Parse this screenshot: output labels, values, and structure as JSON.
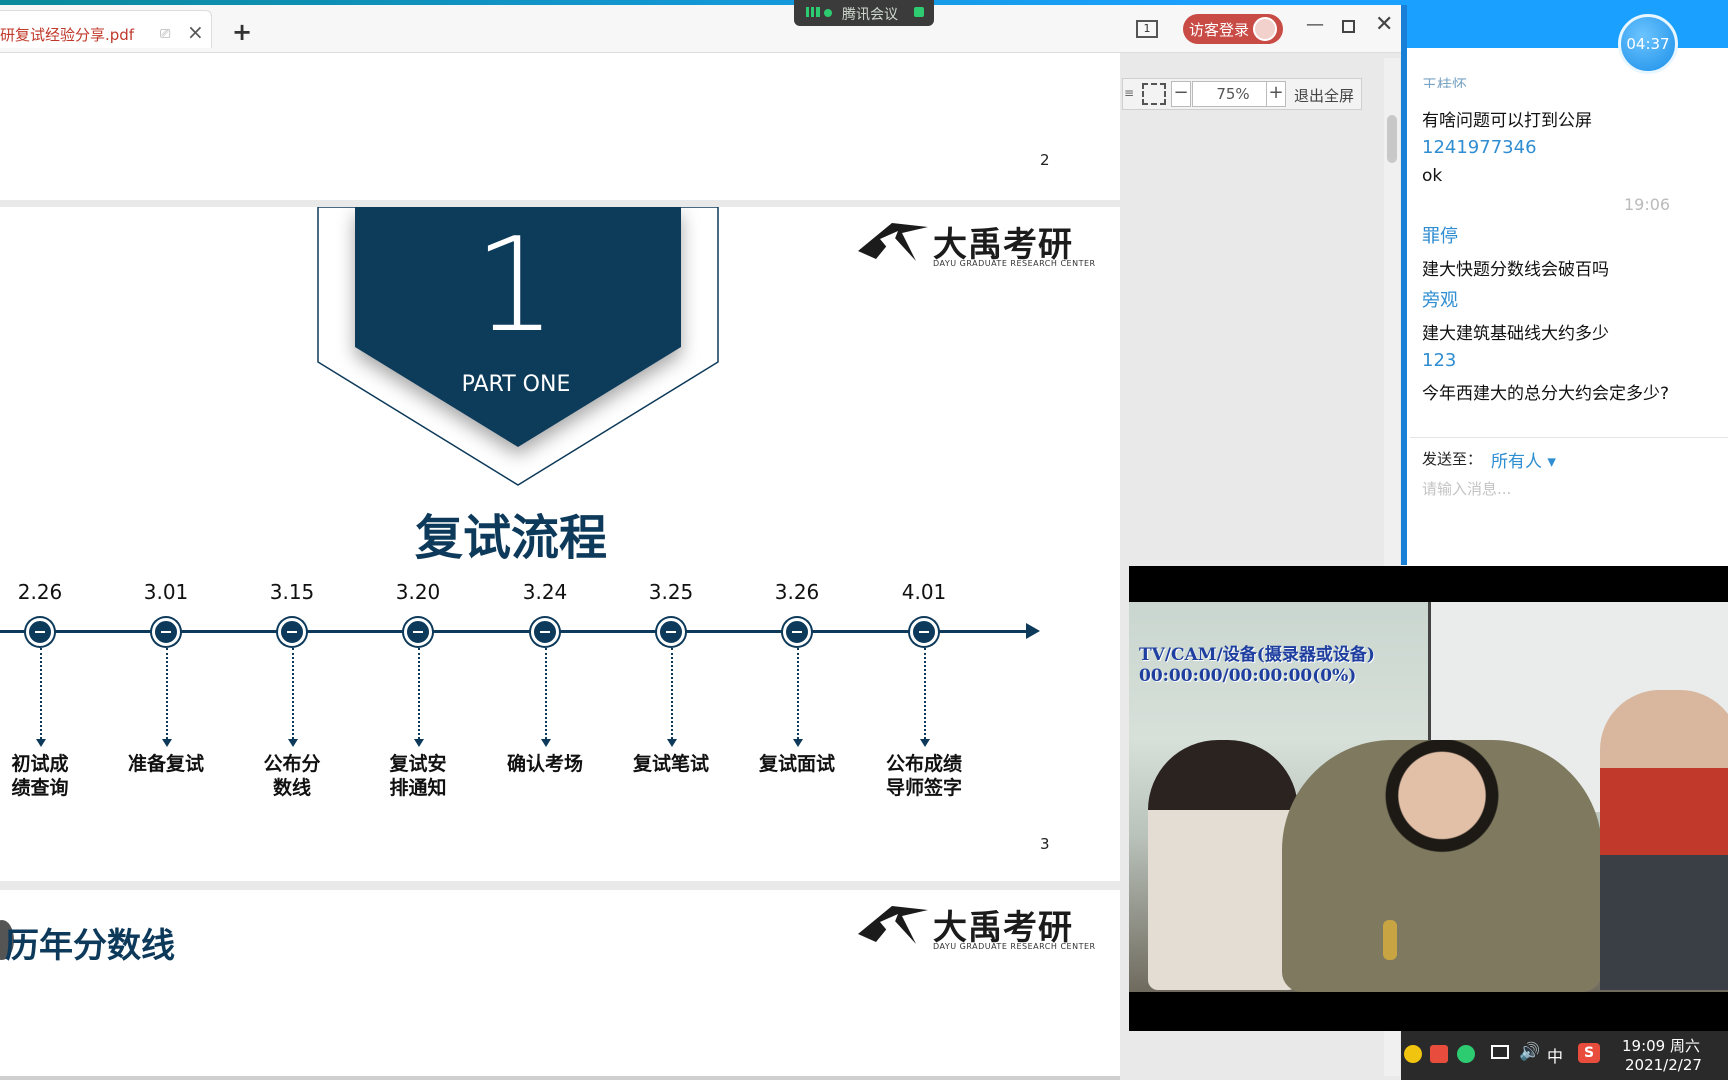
{
  "viewer": {
    "tab_title": "研复试经验分享.pdf",
    "new_tab": "+",
    "tab_close": "×",
    "page_count_icon": "1",
    "login_label": "访客登录",
    "window_min": "—",
    "window_close": "✕",
    "zoom_value": "75%",
    "zoom_minus": "−",
    "zoom_plus": "+",
    "exit_fullscreen": "退出全屏",
    "menu_glyph": "≡"
  },
  "meeting": {
    "label": "腾讯会议"
  },
  "pages": {
    "page2_number": "2",
    "page3_number": "3",
    "logo_zh": "大禹考研",
    "logo_en": "DAYU GRADUATE RESEARCH CENTER",
    "part_number": "1",
    "part_label": "PART ONE",
    "flow_title": "复试流程",
    "history_title": "历年分数线"
  },
  "timeline": [
    {
      "date": "2.26",
      "label_lines": [
        "初试成",
        "绩查询"
      ]
    },
    {
      "date": "3.01",
      "label_lines": [
        "准备复试"
      ]
    },
    {
      "date": "3.15",
      "label_lines": [
        "公布分",
        "数线"
      ]
    },
    {
      "date": "3.20",
      "label_lines": [
        "复试安",
        "排通知"
      ]
    },
    {
      "date": "3.24",
      "label_lines": [
        "确认考场"
      ]
    },
    {
      "date": "3.25",
      "label_lines": [
        "复试笔试"
      ]
    },
    {
      "date": "3.26",
      "label_lines": [
        "复试面试"
      ]
    },
    {
      "date": "4.01",
      "label_lines": [
        "公布成绩",
        "导师签字"
      ]
    }
  ],
  "chat": {
    "timer": "04:37",
    "partial_name": "王桂怀",
    "messages": [
      {
        "name": "",
        "text": "有啥问题可以打到公屏"
      },
      {
        "name": "1241977346",
        "text": "ok"
      },
      {
        "name": "罪停",
        "text": "建大快题分数线会破百吗"
      },
      {
        "name": "旁观",
        "text": "建大建筑基础线大约多少"
      },
      {
        "name": "123",
        "text": "今年西建大的总分大约会定多少?"
      }
    ],
    "time_stamp": "19:06",
    "send_to_label": "发送至：",
    "recipient": "所有人 ▾",
    "input_placeholder": "请输入消息..."
  },
  "video": {
    "overlay_line1": "TV/CAM/设备(摄录器或设备)",
    "overlay_line2": "00:00:00/00:00:00(0%)"
  },
  "taskbar": {
    "time": "19:09 周六",
    "date": "2021/2/27",
    "ime": "中",
    "volume": "🔊",
    "sogou": "S"
  },
  "colors": {
    "accent": "#1aa1ff",
    "slide_navy": "#0d3a5a",
    "login_red": "#c94b45",
    "chat_name": "#2f8dd1"
  }
}
